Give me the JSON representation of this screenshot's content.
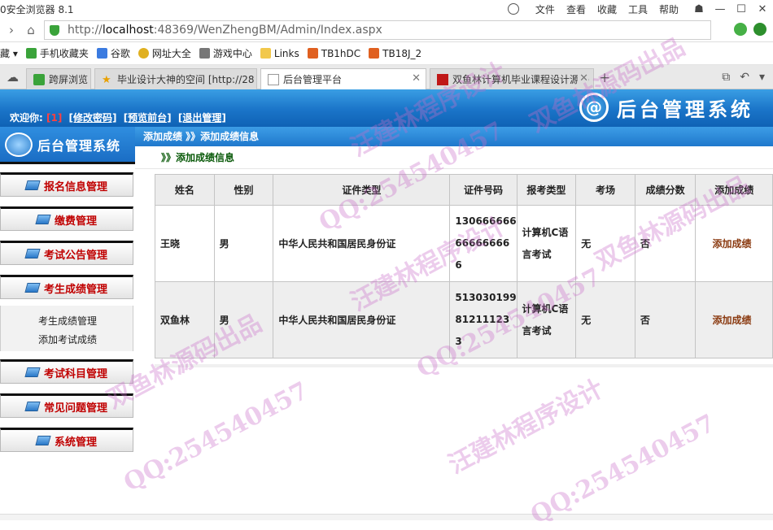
{
  "browser": {
    "app_title": "0安全浏览器 8.1",
    "menu": [
      "文件",
      "查看",
      "收藏",
      "工具",
      "帮助"
    ],
    "url_prefix": "http://",
    "url_host": "localhost",
    "url_rest": ":48369/WenZhengBM/Admin/Index.aspx",
    "favorites": [
      "藏 ▾",
      "手机收藏夹",
      "谷歌",
      "网址大全",
      "游戏中心",
      "Links",
      "TB1hDC",
      "TB18J_2"
    ],
    "tabs": [
      {
        "label": "跨屏浏览"
      },
      {
        "label": "毕业设计大神的空间 [http://28"
      },
      {
        "label": "后台管理平台"
      },
      {
        "label": "双鱼林计算机毕业课程设计源码"
      }
    ]
  },
  "header": {
    "welcome_label": "欢迎你:",
    "user": "[1]",
    "links": [
      "[修改密码]",
      "[预览前台]",
      "[退出管理]"
    ],
    "logo_glyph": "@",
    "system_name": "后台管理系统"
  },
  "sidebar": {
    "title": "后台管理系统",
    "items": [
      {
        "label": "报名信息管理"
      },
      {
        "label": "缴费管理"
      },
      {
        "label": "考试公告管理"
      },
      {
        "label": "考生成绩管理"
      },
      {
        "label": "考试科目管理"
      },
      {
        "label": "常见问题管理"
      },
      {
        "label": "系统管理"
      }
    ],
    "submenu": [
      "考生成绩管理",
      "添加考试成绩"
    ]
  },
  "content": {
    "breadcrumb": "添加成绩 》》添加成绩信息",
    "subtitle": "》》添加成绩信息",
    "columns": [
      "姓名",
      "性别",
      "证件类型",
      "证件号码",
      "报考类型",
      "考场",
      "成绩分数",
      "添加成绩"
    ],
    "rows": [
      {
        "name": "王晓",
        "gender": "男",
        "id_type": "中华人民共和国居民身份证",
        "id_lines": [
          "130666666",
          "66666666",
          "6"
        ],
        "exam_lines": [
          "计算机C语",
          "言考试"
        ],
        "room": "无",
        "score": "否",
        "action": "添加成绩"
      },
      {
        "name": "双鱼林",
        "gender": "男",
        "id_type": "中华人民共和国居民身份证",
        "id_lines": [
          "513030199",
          "81211123",
          "3"
        ],
        "exam_lines": [
          "计算机C语",
          "言考试"
        ],
        "room": "无",
        "score": "否",
        "action": "添加成绩"
      }
    ]
  },
  "watermarks": [
    "QQ:254540457",
    "双鱼林源码出品",
    "汪建林程序设计",
    "QQ:254540457",
    "双鱼林源码出品",
    "汪建林程序设计",
    "QQ:254540457",
    "双鱼林源码出品",
    "汪建林程序设计",
    "QQ:254540457"
  ]
}
